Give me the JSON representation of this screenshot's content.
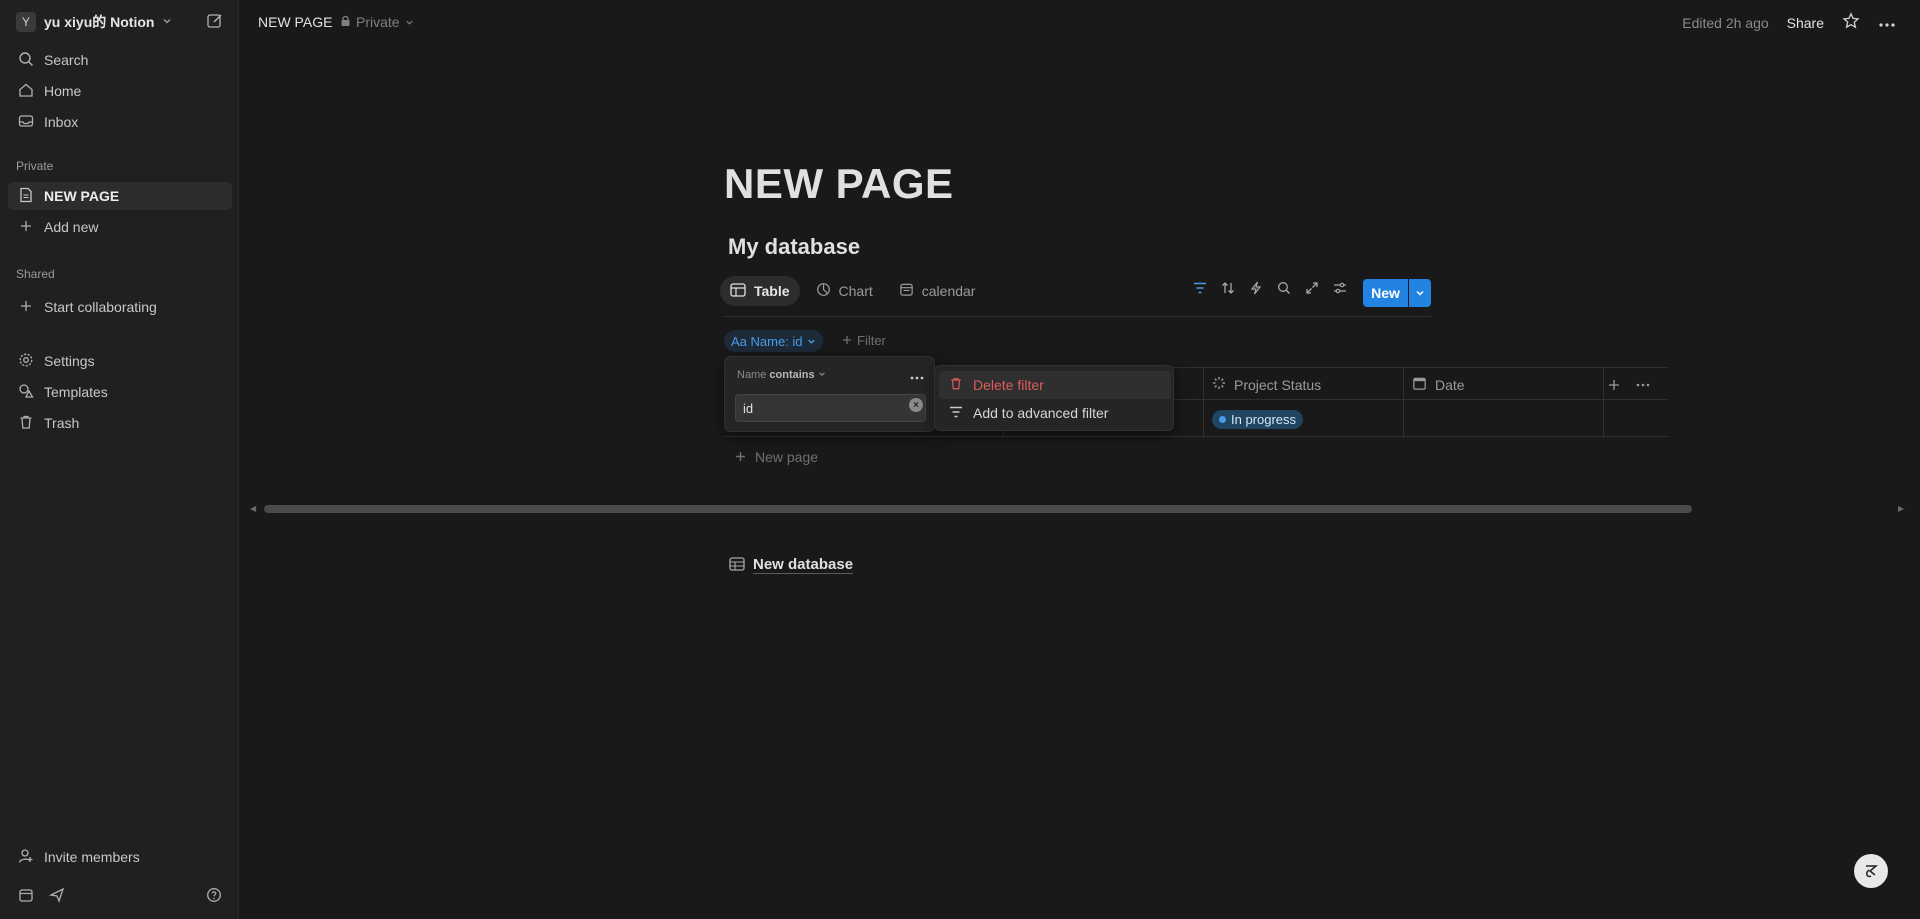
{
  "workspace": {
    "avatar": "Y",
    "name": "yu xiyu的 Notion"
  },
  "sidebar": {
    "top_items": [
      {
        "label": "Search",
        "icon": "search-icon"
      },
      {
        "label": "Home",
        "icon": "home-icon"
      },
      {
        "label": "Inbox",
        "icon": "inbox-icon"
      }
    ],
    "private_section": "Private",
    "private_items": [
      {
        "label": "NEW PAGE",
        "icon": "page-icon"
      },
      {
        "label": "Add new",
        "icon": "plus-icon"
      }
    ],
    "shared_section": "Shared",
    "shared_items": [
      {
        "label": "Start collaborating",
        "icon": "plus-icon"
      }
    ],
    "bottom_items": [
      {
        "label": "Settings",
        "icon": "gear-icon"
      },
      {
        "label": "Templates",
        "icon": "templates-icon"
      },
      {
        "label": "Trash",
        "icon": "trash-icon"
      }
    ],
    "invite": "Invite members"
  },
  "topbar": {
    "title": "NEW PAGE",
    "privacy": "Private",
    "edited": "Edited 2h ago",
    "share": "Share"
  },
  "page": {
    "title": "NEW PAGE"
  },
  "database": {
    "title": "My database",
    "views": [
      {
        "label": "Table",
        "icon": "table-icon"
      },
      {
        "label": "Chart",
        "icon": "chart-icon"
      },
      {
        "label": "calendar",
        "icon": "calendar-icon"
      }
    ],
    "new_button": "New",
    "filter_chip": "Aa Name: id",
    "add_filter": "Filter",
    "columns": [
      {
        "label": "Project Status",
        "icon": "status-icon"
      },
      {
        "label": "Date",
        "icon": "calendar-icon"
      }
    ],
    "rows": [
      {
        "status": "In progress"
      }
    ],
    "new_page": "New page"
  },
  "filter_popup": {
    "property": "Name",
    "operator": "contains",
    "value": "id"
  },
  "context_menu": {
    "delete": "Delete filter",
    "advanced": "Add to advanced filter"
  },
  "linked_database": {
    "label": "New database"
  },
  "colors": {
    "accent": "#2383e2",
    "danger": "#e05b5b",
    "background": "#191919",
    "sidebar": "#202020"
  }
}
